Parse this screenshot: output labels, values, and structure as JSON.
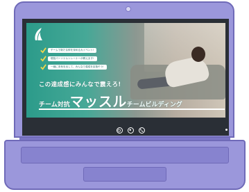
{
  "banner": {
    "checklist": [
      "チームで新たな絆を深める大イベント!",
      "現役パーソナルトレーナーが教えます!",
      "一緒に本気を出して、みんなで達成を目指そう!"
    ],
    "tagline": "この達成感にみんなで震えろ!",
    "title_pre": "チーム対抗",
    "title_main": "マッスル",
    "title_post": "チームビルディング"
  },
  "colors": {
    "laptop": "#9b97db",
    "laptop_outline": "#6f6ab8",
    "banner_teal": "#2c9b8a",
    "screen_frame": "#2a2f36"
  },
  "taskbar": {
    "icons": [
      "power-icon",
      "record-icon",
      "phone-icon"
    ]
  }
}
